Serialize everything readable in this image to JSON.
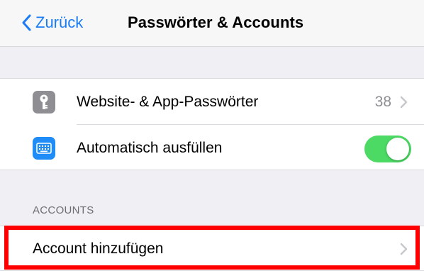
{
  "navbar": {
    "back_label": "Zurück",
    "title": "Passwörter & Accounts"
  },
  "rows": {
    "passwords": {
      "label": "Website- & App-Passwörter",
      "value": "38",
      "icon": "key-icon"
    },
    "autofill": {
      "label": "Automatisch ausfüllen",
      "icon": "keyboard-icon",
      "toggle_on": true
    }
  },
  "accounts_section": {
    "header": "ACCOUNTS",
    "add_label": "Account hinzufügen"
  },
  "colors": {
    "accent": "#1a7cf5",
    "toggle_on": "#4cd964",
    "highlight": "#ff0000",
    "background": "#efeff4"
  }
}
